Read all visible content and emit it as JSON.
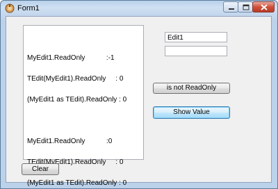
{
  "window": {
    "title": "Form1"
  },
  "memo": {
    "lines": [
      "MyEdit1.ReadOnly           :-1",
      "TEdit(MyEdit1).ReadOnly     : 0",
      "(MyEdit1 as TEdit).ReadOnly : 0",
      "",
      "MyEdit1.ReadOnly           :0",
      "TEdit(MyEdit1).ReadOnly     : 0",
      "(MyEdit1 as TEdit).ReadOnly : 0"
    ]
  },
  "edits": {
    "edit1_value": "Edit1",
    "edit2_value": ""
  },
  "buttons": {
    "readonly_label": "is not ReadOnly",
    "show_value_label": "Show Value",
    "clear_label": "Clear"
  },
  "colors": {
    "title_bar": "#b9d1ea",
    "close_button": "#c9452f",
    "focused_button_border": "#3c7fb1"
  }
}
